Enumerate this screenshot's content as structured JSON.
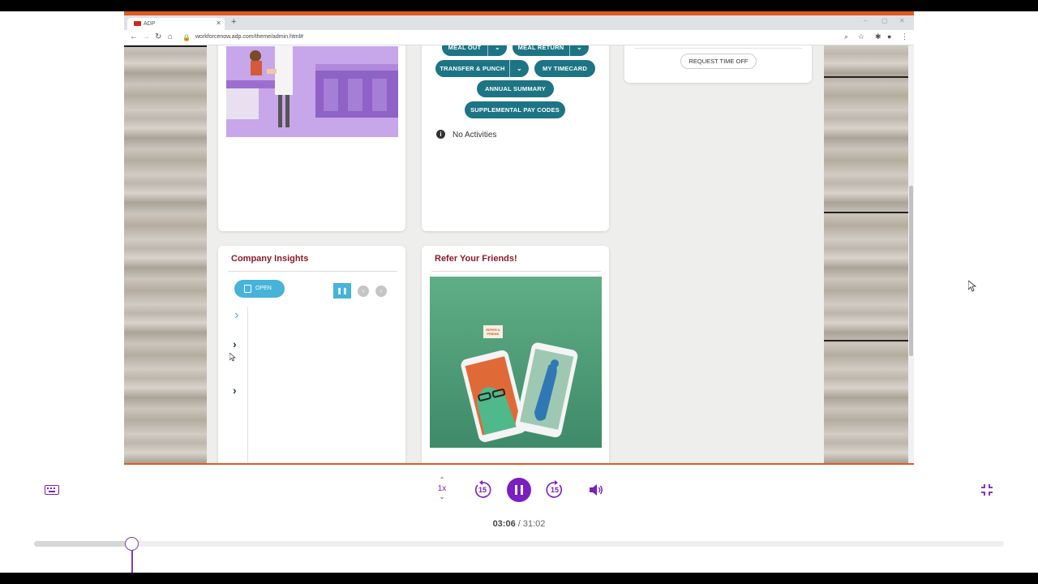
{
  "browser": {
    "tab_title": "ADP",
    "url": "workforcenow.adp.com/theme/admin.html#"
  },
  "timecard_card": {
    "buttons": {
      "meal_out": "MEAL OUT",
      "meal_return": "MEAL RETURN",
      "transfer_punch": "TRANSFER & PUNCH",
      "my_timecard": "MY TIMECARD",
      "annual_summary": "ANNUAL SUMMARY",
      "supplemental_pay_codes": "SUPPLEMENTAL PAY CODES"
    },
    "no_activities": "No Activities"
  },
  "timeoff_card": {
    "request_button": "REQUEST TIME OFF"
  },
  "insights_card": {
    "title": "Company Insights",
    "open_button": "OPEN"
  },
  "refer_card": {
    "title": "Refer Your Friends!",
    "badge": "REFER A FRIEND"
  },
  "player": {
    "speed": "1x",
    "rewind_seconds": "15",
    "forward_seconds": "15",
    "current_time": "03:06",
    "separator": "/",
    "total_time": "31:02",
    "progress": 0.1
  },
  "colors": {
    "accent_orange": "#e05a1e",
    "teal": "#1d7484",
    "maroon_title": "#8b1a2b",
    "player_purple": "#7a1fc2"
  }
}
